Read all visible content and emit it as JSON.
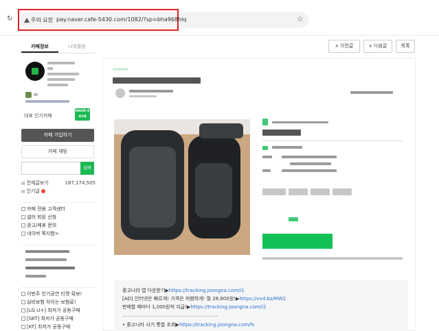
{
  "browser": {
    "security_warning": "주의 요함",
    "url": "pay.naver.cafe-5430.com/1082/?sp=bha968hlq"
  },
  "sidebar": {
    "tabs": [
      "카페정보",
      "나의활동"
    ],
    "rep_cafe_label": "대표 인기카페",
    "naver_badge": "NAVER 대표카페",
    "join_button": "카페 가입하기",
    "chat_button": "카페 채팅",
    "search_button": "검색",
    "stats": [
      {
        "label": "전체글보기",
        "value": "187,174,505"
      },
      {
        "label": "인기글",
        "value": ""
      }
    ],
    "menu_group_1": [
      "카페 전용 고객센터",
      "셀러 회원 신청",
      "광고/제휴 문의",
      "네이버 쪽지함>"
    ],
    "menu_group_2": [
      "이번주 인기공연 티켓 확보!",
      "실비보험 차이는 보험료!",
      "[LG U+] 최저가 공동구매",
      "[SKT] 최저가 공동구매",
      "[KT] 최저가 공동구매"
    ]
  },
  "nav_buttons": {
    "prev": "∧ 이전글",
    "next": "∨ 다음글",
    "list": "목록"
  },
  "ad_box": {
    "line1_text": "중고나라 앱 다운받기▶",
    "line1_link": "https://tracking.joongna.com/i1",
    "line2_text": "[AD] 인터넷은 빠르게! 가격은 저렴하게! 월 28,600원!▶",
    "line2_link": "https://vvd.bz/MW2",
    "line3_text": "판매할 때마다 1,000원씩 지급!▶",
    "line3_link": "https://tracking.joongna.com/i2",
    "line4_text": "• 중고나라 사기 통합 조회▶",
    "line4_link": "https://tracking.joongna.com/fs"
  },
  "colors": {
    "highlight_box": "#e02020",
    "naver_green": "#1db954",
    "cta_green": "#13c256",
    "link_blue": "#2a6fc9"
  }
}
